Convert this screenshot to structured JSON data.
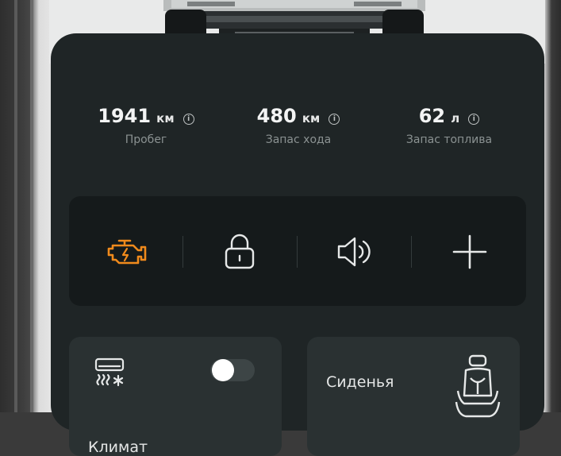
{
  "stats": [
    {
      "value": "1941",
      "unit": "км",
      "label": "Пробег"
    },
    {
      "value": "480",
      "unit": "км",
      "label": "Запас хода"
    },
    {
      "value": "62",
      "unit": "л",
      "label": "Запас топлива"
    }
  ],
  "quick_actions": [
    {
      "icon": "engine-warning-icon",
      "color": "#f08a1c"
    },
    {
      "icon": "lock-icon",
      "color": "#e6e8e8"
    },
    {
      "icon": "speaker-icon",
      "color": "#e6e8e8"
    },
    {
      "icon": "plus-icon",
      "color": "#e6e8e8"
    }
  ],
  "cards": {
    "climate": {
      "icon": "climate-icon",
      "label": "Климат",
      "toggle_on": false
    },
    "seats": {
      "icon": "seat-icon",
      "label": "Сиденья"
    }
  },
  "info_glyph": "i",
  "colors": {
    "panel": "#1f2526",
    "accent": "#f08a1c",
    "card": "#2a3132"
  }
}
